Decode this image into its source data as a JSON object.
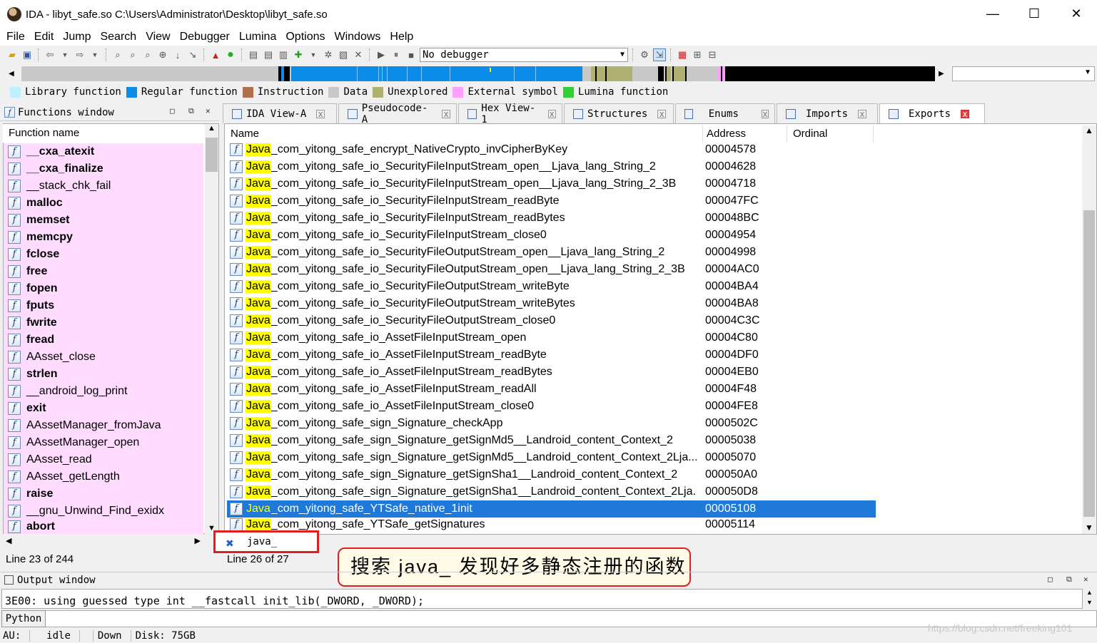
{
  "window": {
    "title": "IDA - libyt_safe.so C:\\Users\\Administrator\\Desktop\\libyt_safe.so",
    "minimize": "—",
    "maximize": "☐",
    "close": "✕"
  },
  "menu": [
    "File",
    "Edit",
    "Jump",
    "Search",
    "View",
    "Debugger",
    "Lumina",
    "Options",
    "Windows",
    "Help"
  ],
  "toolbar": {
    "debugger_select": "No debugger"
  },
  "legend": [
    {
      "label": "Library function",
      "color": "#c0f0ff"
    },
    {
      "label": "Regular function",
      "color": "#0a8ce8"
    },
    {
      "label": "Instruction",
      "color": "#b07050"
    },
    {
      "label": "Data",
      "color": "#c8c8c8"
    },
    {
      "label": "Unexplored",
      "color": "#b0b070"
    },
    {
      "label": "External symbol",
      "color": "#ffa0ff"
    },
    {
      "label": "Lumina function",
      "color": "#30d030"
    }
  ],
  "functions_window": {
    "title": "Functions window",
    "column": "Function name",
    "items": [
      {
        "name": "__cxa_atexit",
        "bold": true
      },
      {
        "name": "__cxa_finalize",
        "bold": true
      },
      {
        "name": "__stack_chk_fail",
        "bold": false
      },
      {
        "name": "malloc",
        "bold": true
      },
      {
        "name": "memset",
        "bold": true
      },
      {
        "name": "memcpy",
        "bold": true
      },
      {
        "name": "fclose",
        "bold": true
      },
      {
        "name": "free",
        "bold": true
      },
      {
        "name": "fopen",
        "bold": true
      },
      {
        "name": "fputs",
        "bold": true
      },
      {
        "name": "fwrite",
        "bold": true
      },
      {
        "name": "fread",
        "bold": true
      },
      {
        "name": "AAsset_close",
        "bold": false
      },
      {
        "name": "strlen",
        "bold": true
      },
      {
        "name": "__android_log_print",
        "bold": false
      },
      {
        "name": "exit",
        "bold": true
      },
      {
        "name": "AAssetManager_fromJava",
        "bold": false
      },
      {
        "name": "AAssetManager_open",
        "bold": false
      },
      {
        "name": "AAsset_read",
        "bold": false
      },
      {
        "name": "AAsset_getLength",
        "bold": false
      },
      {
        "name": "raise",
        "bold": true
      },
      {
        "name": "__gnu_Unwind_Find_exidx",
        "bold": false
      },
      {
        "name": "abort",
        "bold": true
      }
    ],
    "status": "Line 23 of 244"
  },
  "tabs": [
    {
      "label": "IDA View-A"
    },
    {
      "label": "Pseudocode-A"
    },
    {
      "label": "Hex View-1"
    },
    {
      "label": "Structures"
    },
    {
      "label": "Enums"
    },
    {
      "label": "Imports"
    },
    {
      "label": "Exports"
    }
  ],
  "exports": {
    "columns": [
      "Name",
      "Address",
      "Ordinal"
    ],
    "highlight": "Java",
    "rows": [
      {
        "rest": "_com_yitong_safe_encrypt_NativeCrypto_invCipherByKey",
        "address": "00004578"
      },
      {
        "rest": "_com_yitong_safe_io_SecurityFileInputStream_open__Ljava_lang_String_2",
        "address": "00004628"
      },
      {
        "rest": "_com_yitong_safe_io_SecurityFileInputStream_open__Ljava_lang_String_2_3B",
        "address": "00004718"
      },
      {
        "rest": "_com_yitong_safe_io_SecurityFileInputStream_readByte",
        "address": "000047FC"
      },
      {
        "rest": "_com_yitong_safe_io_SecurityFileInputStream_readBytes",
        "address": "000048BC"
      },
      {
        "rest": "_com_yitong_safe_io_SecurityFileInputStream_close0",
        "address": "00004954"
      },
      {
        "rest": "_com_yitong_safe_io_SecurityFileOutputStream_open__Ljava_lang_String_2",
        "address": "00004998"
      },
      {
        "rest": "_com_yitong_safe_io_SecurityFileOutputStream_open__Ljava_lang_String_2_3B",
        "address": "00004AC0"
      },
      {
        "rest": "_com_yitong_safe_io_SecurityFileOutputStream_writeByte",
        "address": "00004BA4"
      },
      {
        "rest": "_com_yitong_safe_io_SecurityFileOutputStream_writeBytes",
        "address": "00004BA8"
      },
      {
        "rest": "_com_yitong_safe_io_SecurityFileOutputStream_close0",
        "address": "00004C3C"
      },
      {
        "rest": "_com_yitong_safe_io_AssetFileInputStream_open",
        "address": "00004C80"
      },
      {
        "rest": "_com_yitong_safe_io_AssetFileInputStream_readByte",
        "address": "00004DF0"
      },
      {
        "rest": "_com_yitong_safe_io_AssetFileInputStream_readBytes",
        "address": "00004EB0"
      },
      {
        "rest": "_com_yitong_safe_io_AssetFileInputStream_readAll",
        "address": "00004F48"
      },
      {
        "rest": "_com_yitong_safe_io_AssetFileInputStream_close0",
        "address": "00004FE8"
      },
      {
        "rest": "_com_yitong_safe_sign_Signature_checkApp",
        "address": "0000502C"
      },
      {
        "rest": "_com_yitong_safe_sign_Signature_getSignMd5__Landroid_content_Context_2",
        "address": "00005038"
      },
      {
        "rest": "_com_yitong_safe_sign_Signature_getSignMd5__Landroid_content_Context_2Lja...",
        "address": "00005070"
      },
      {
        "rest": "_com_yitong_safe_sign_Signature_getSignSha1__Landroid_content_Context_2",
        "address": "000050A0"
      },
      {
        "rest": "_com_yitong_safe_sign_Signature_getSignSha1__Landroid_content_Context_2Lja...",
        "address": "000050D8"
      },
      {
        "rest": "_com_yitong_safe_YTSafe_native_1init",
        "address": "00005108",
        "selected": true
      },
      {
        "rest": "_com_yitong_safe_YTSafe_getSignatures",
        "address": "00005114"
      }
    ],
    "search_value": "java_",
    "status": "Line 26 of 27"
  },
  "callout": "搜索 java_ 发现好多静态注册的函数",
  "output_window": {
    "title": "Output window",
    "line": "3E00: using guessed type int __fastcall init_lib(_DWORD, _DWORD);",
    "python_button": "Python"
  },
  "statusbar": {
    "au": "AU:",
    "state": "idle",
    "dir": "Down",
    "disk": "Disk: 75GB"
  },
  "watermark": "https://blog.csdn.net/freeking101"
}
